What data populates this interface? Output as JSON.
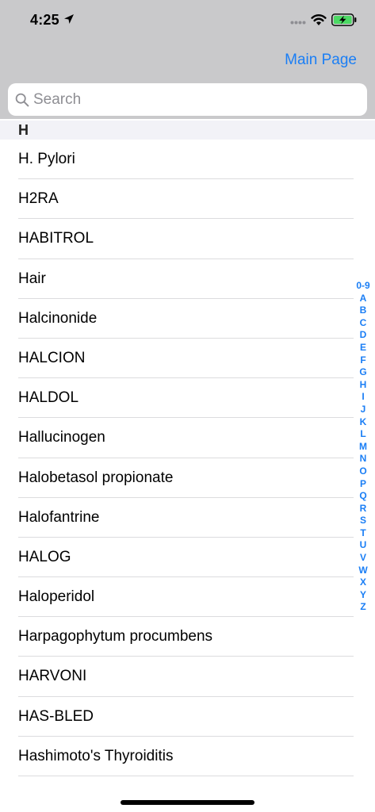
{
  "status_bar": {
    "time": "4:25",
    "icons": [
      "location-arrow-icon",
      "cellular-signal-icon",
      "wifi-icon",
      "battery-charging-icon"
    ]
  },
  "nav": {
    "main_page_label": "Main Page"
  },
  "search": {
    "placeholder": "Search",
    "value": ""
  },
  "section": {
    "header": "H"
  },
  "items": [
    "H. Pylori",
    "H2RA",
    "HABITROL",
    "Hair",
    "Halcinonide",
    "HALCION",
    "HALDOL",
    "Hallucinogen",
    "Halobetasol propionate",
    "Halofantrine",
    "HALOG",
    "Haloperidol",
    "Harpagophytum procumbens",
    "HARVONI",
    "HAS-BLED",
    "Hashimoto's Thyroiditis"
  ],
  "index": [
    "0-9",
    "A",
    "B",
    "C",
    "D",
    "E",
    "F",
    "G",
    "H",
    "I",
    "J",
    "K",
    "L",
    "M",
    "N",
    "O",
    "P",
    "Q",
    "R",
    "S",
    "T",
    "U",
    "V",
    "W",
    "X",
    "Y",
    "Z"
  ],
  "colors": {
    "accent": "#1a7ef5",
    "nav_background": "#c9c9cb",
    "battery_green": "#4cd964"
  }
}
